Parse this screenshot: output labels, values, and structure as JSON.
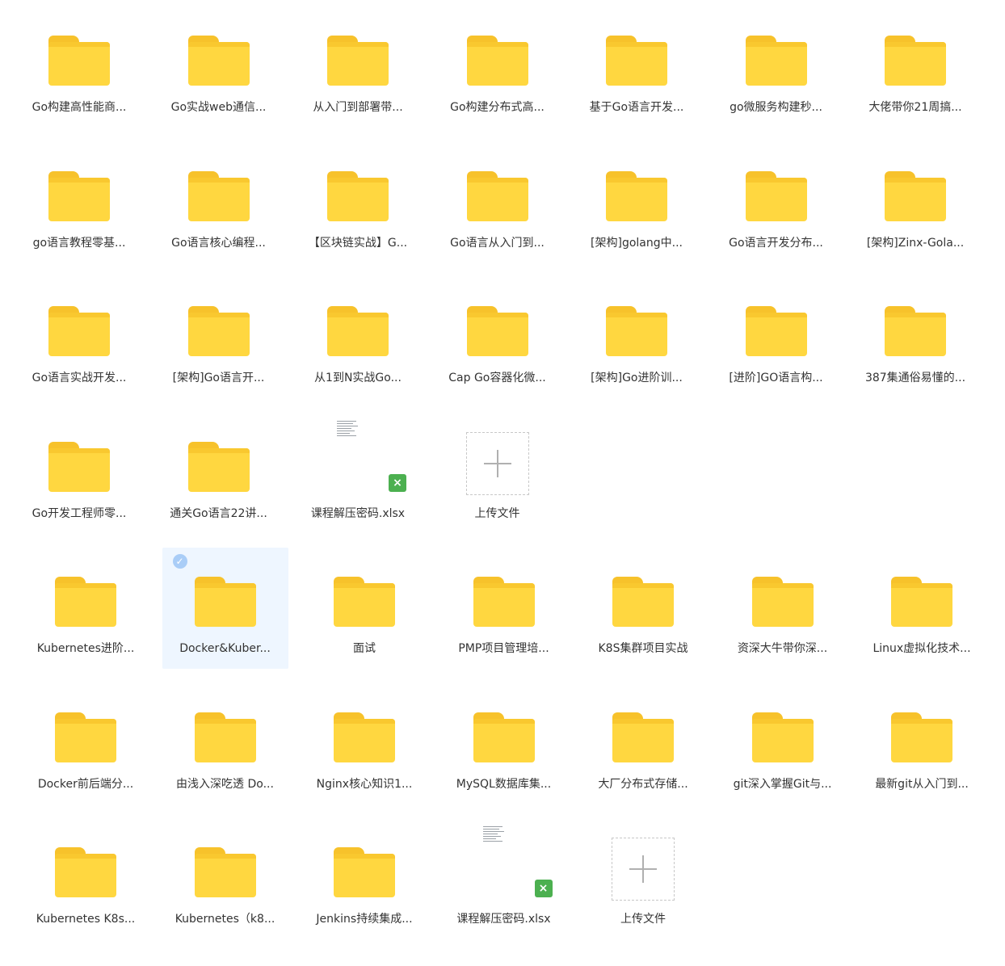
{
  "section1": {
    "items": [
      {
        "type": "folder",
        "label": "Go构建高性能商..."
      },
      {
        "type": "folder",
        "label": "Go实战web通信..."
      },
      {
        "type": "folder",
        "label": "从入门到部署带..."
      },
      {
        "type": "folder",
        "label": "Go构建分布式高..."
      },
      {
        "type": "folder",
        "label": "基于Go语言开发..."
      },
      {
        "type": "folder",
        "label": "go微服务构建秒..."
      },
      {
        "type": "folder",
        "label": "大佬带你21周搞..."
      },
      {
        "type": "folder",
        "label": "go语言教程零基..."
      },
      {
        "type": "folder",
        "label": "Go语言核心编程..."
      },
      {
        "type": "folder",
        "label": "【区块链实战】G..."
      },
      {
        "type": "folder",
        "label": "Go语言从入门到..."
      },
      {
        "type": "folder",
        "label": "[架构]golang中..."
      },
      {
        "type": "folder",
        "label": "Go语言开发分布..."
      },
      {
        "type": "folder",
        "label": "[架构]Zinx-Gola..."
      },
      {
        "type": "folder",
        "label": "Go语言实战开发..."
      },
      {
        "type": "folder",
        "label": "[架构]Go语言开..."
      },
      {
        "type": "folder",
        "label": "从1到N实战Go..."
      },
      {
        "type": "folder",
        "label": "Cap Go容器化微..."
      },
      {
        "type": "folder",
        "label": "[架构]Go进阶训..."
      },
      {
        "type": "folder",
        "label": "[进阶]GO语言构..."
      },
      {
        "type": "folder",
        "label": "387集通俗易懂的..."
      },
      {
        "type": "folder",
        "label": "Go开发工程师零..."
      },
      {
        "type": "folder",
        "label": "通关Go语言22讲..."
      },
      {
        "type": "xlsx",
        "label": "课程解压密码.xlsx"
      },
      {
        "type": "upload",
        "label": "上传文件"
      }
    ]
  },
  "section2": {
    "items": [
      {
        "type": "folder",
        "label": "Kubernetes进阶..."
      },
      {
        "type": "folder",
        "label": "Docker&Kuber...",
        "selected": true
      },
      {
        "type": "folder",
        "label": "面试"
      },
      {
        "type": "folder",
        "label": "PMP项目管理培..."
      },
      {
        "type": "folder",
        "label": "K8S集群项目实战"
      },
      {
        "type": "folder",
        "label": "资深大牛带你深..."
      },
      {
        "type": "folder",
        "label": "Linux虚拟化技术..."
      },
      {
        "type": "folder",
        "label": "Docker前后端分..."
      },
      {
        "type": "folder",
        "label": "由浅入深吃透 Do..."
      },
      {
        "type": "folder",
        "label": "Nginx核心知识1..."
      },
      {
        "type": "folder",
        "label": "MySQL数据库集..."
      },
      {
        "type": "folder",
        "label": "大厂分布式存储..."
      },
      {
        "type": "folder",
        "label": "git深入掌握Git与..."
      },
      {
        "type": "folder",
        "label": "最新git从入门到..."
      },
      {
        "type": "folder",
        "label": "Kubernetes K8s..."
      },
      {
        "type": "folder",
        "label": "Kubernetes（k8..."
      },
      {
        "type": "folder",
        "label": "Jenkins持续集成..."
      },
      {
        "type": "xlsx",
        "label": "课程解压密码.xlsx"
      },
      {
        "type": "upload",
        "label": "上传文件"
      }
    ]
  },
  "colors": {
    "folder_body": "#ffd740",
    "folder_tab": "#f7c22b",
    "selected_bg": "#eef6ff",
    "check": "#a9cdf7",
    "xlsx_badge": "#4cb050"
  }
}
